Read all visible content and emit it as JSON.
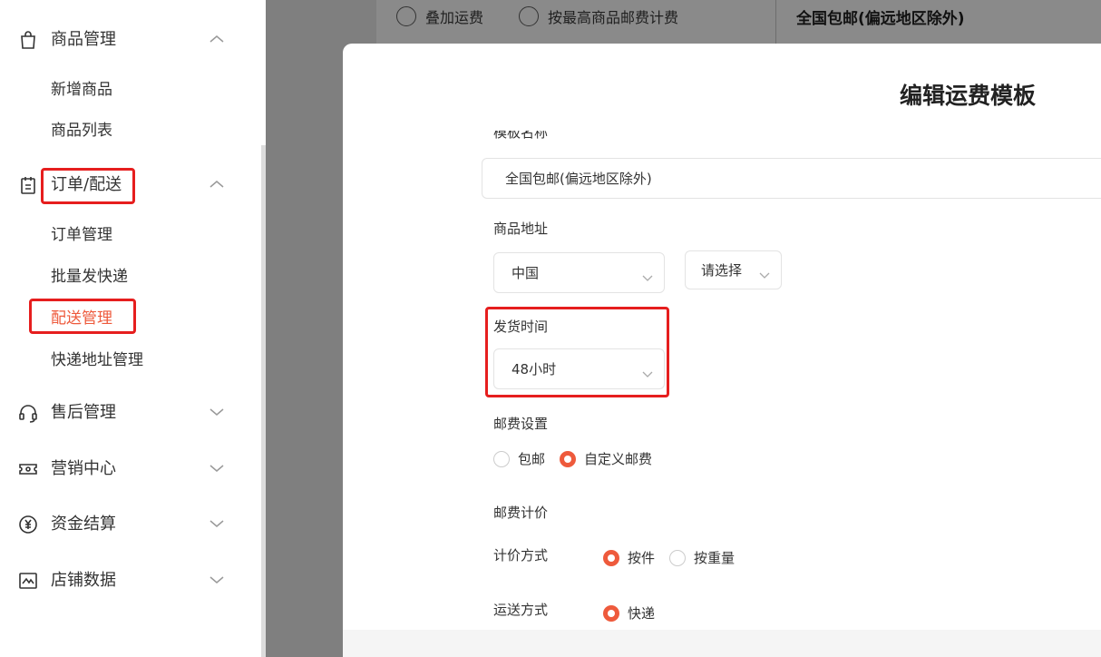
{
  "sidebar": {
    "groups": [
      {
        "label": "商品管理",
        "icon": "shopping-bag-icon",
        "state": "expanded",
        "items": [
          "新增商品",
          "商品列表"
        ]
      },
      {
        "label": "订单/配送",
        "icon": "order-clipboard-icon",
        "state": "expanded",
        "items": [
          "订单管理",
          "批量发快递",
          "配送管理",
          "快递地址管理"
        ],
        "active_item": "配送管理"
      },
      {
        "label": "售后管理",
        "icon": "headset-icon",
        "state": "collapsed"
      },
      {
        "label": "营销中心",
        "icon": "ticket-icon",
        "state": "collapsed"
      },
      {
        "label": "资金结算",
        "icon": "yen-coin-icon",
        "state": "collapsed"
      },
      {
        "label": "店铺数据",
        "icon": "chart-icon",
        "state": "collapsed"
      }
    ]
  },
  "background": {
    "radio_1": "叠加运费",
    "radio_2": "按最高商品邮费计费",
    "template_name": "全国包邮(偏远地区除外)"
  },
  "modal": {
    "title": "编辑运费模板",
    "template_name_label": "模板名称",
    "template_name_value": "全国包邮(偏远地区除外)",
    "address_label": "商品地址",
    "country_value": "中国",
    "region_placeholder": "请选择",
    "ship_time_label": "发货时间",
    "ship_time_value": "48小时",
    "postage_setting_label": "邮费设置",
    "postage_options": [
      "包邮",
      "自定义邮费"
    ],
    "postage_selected": "自定义邮费",
    "postage_pricing_label": "邮费计价",
    "pricing_method_label": "计价方式",
    "pricing_options": [
      "按件",
      "按重量"
    ],
    "pricing_selected": "按件",
    "delivery_label": "运送方式",
    "delivery_option": "快递"
  },
  "colors": {
    "accent": "#ee5a3c",
    "highlight_box": "#e61e1e",
    "overlay": "#7f7f7f"
  }
}
